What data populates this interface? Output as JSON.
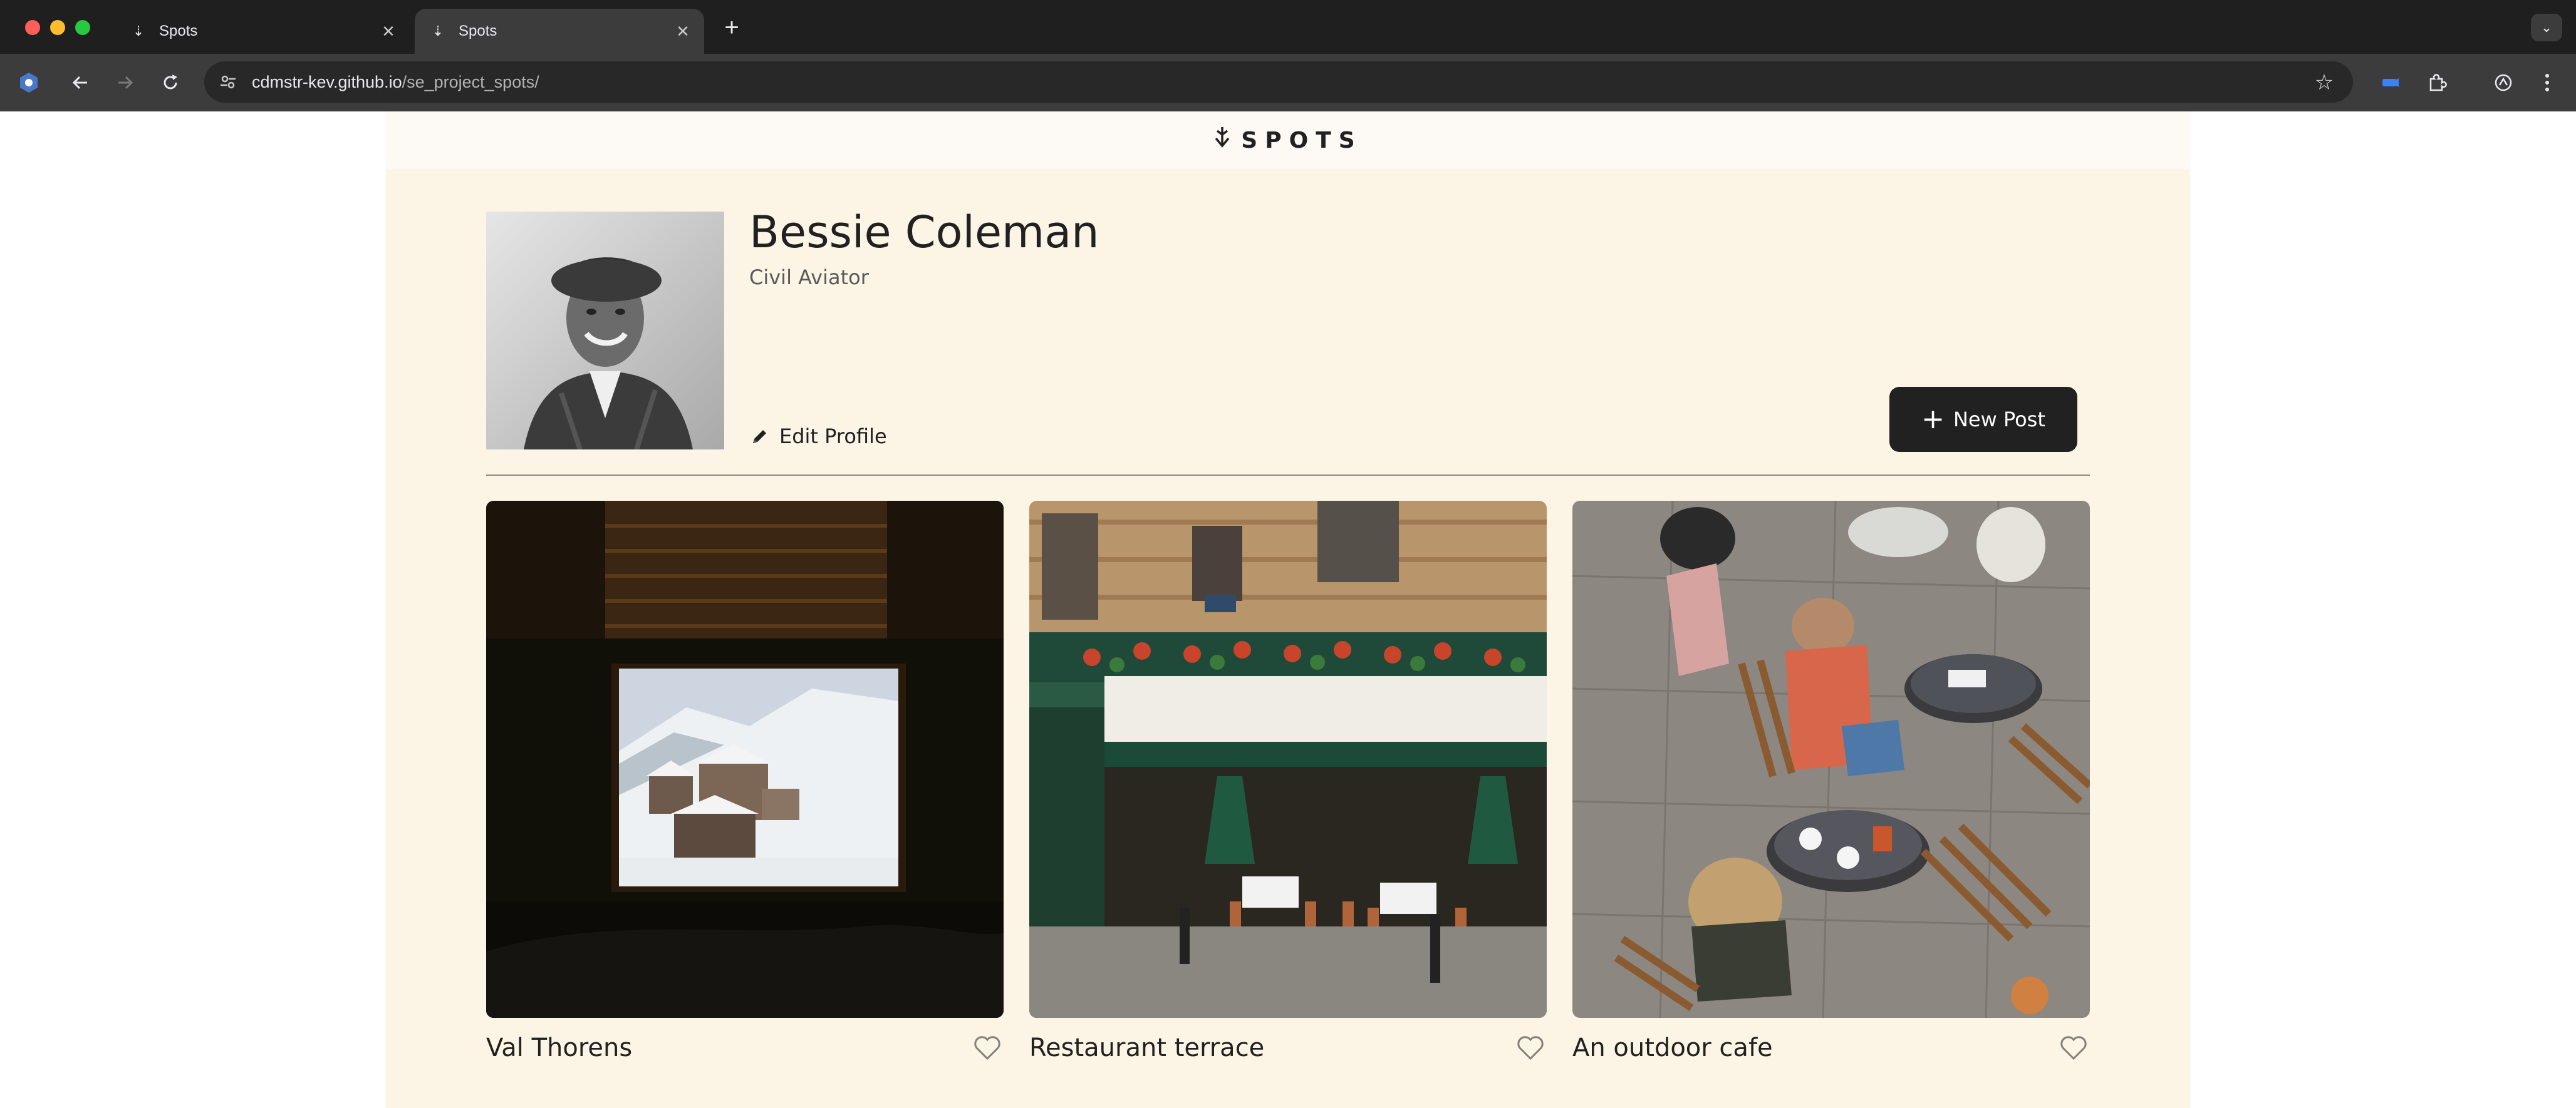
{
  "browser": {
    "tabs": [
      {
        "title": "Spots",
        "favicon": "spots-logo-icon"
      },
      {
        "title": "Spots",
        "favicon": "spots-logo-icon"
      }
    ],
    "url_domain": "cdmstr-kev.github.io",
    "url_path": "/se_project_spots/"
  },
  "header": {
    "logo_text": "SPOTS"
  },
  "profile": {
    "name": "Bessie Coleman",
    "description": "Civil Aviator",
    "edit_label": "Edit Profile",
    "new_post_label": "New Post"
  },
  "cards": [
    {
      "title": "Val Thorens"
    },
    {
      "title": "Restaurant terrace"
    },
    {
      "title": "An outdoor cafe"
    }
  ],
  "colors": {
    "page_background": "#fcf5e5",
    "header_background": "#fdfaf6",
    "text_dark": "#212121",
    "button_dark": "#212121"
  }
}
